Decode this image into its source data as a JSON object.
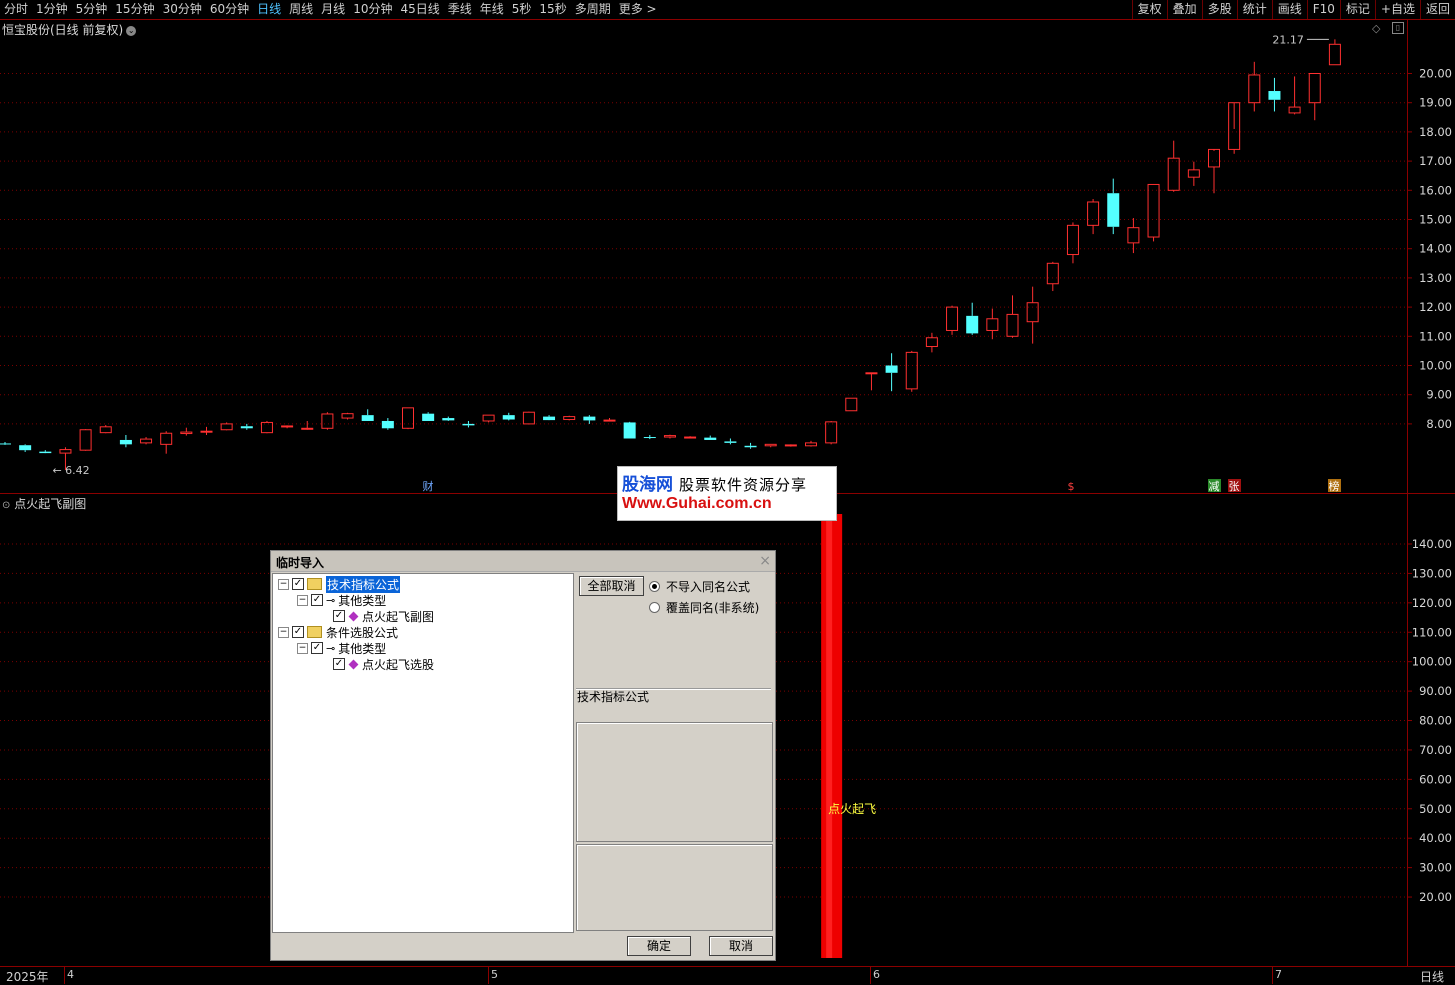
{
  "toolbar": {
    "tabs": [
      "分时",
      "1分钟",
      "5分钟",
      "15分钟",
      "30分钟",
      "60分钟",
      "日线",
      "周线",
      "月线",
      "10分钟",
      "45日线",
      "季线",
      "年线",
      "5秒",
      "15秒",
      "多周期",
      "更多 >"
    ],
    "active_tab": "日线",
    "right_tools": [
      "复权",
      "叠加",
      "多股",
      "统计",
      "画线",
      "F10",
      "标记",
      "+自选",
      "返回"
    ]
  },
  "main_chart": {
    "title": "恒宝股份(日线 前复权)",
    "high_label": "21.17",
    "low_label": "6.42",
    "y_axis": [
      "20.00",
      "19.00",
      "18.00",
      "17.00",
      "16.00",
      "15.00",
      "14.00",
      "13.00",
      "12.00",
      "11.00",
      "10.00",
      "9.00",
      "8.00"
    ],
    "markers": [
      "财",
      "$",
      "减",
      "张",
      "榜"
    ]
  },
  "sub_chart": {
    "title": "点火起飞副图",
    "signal_label": "点火起飞",
    "y_axis": [
      "140.00",
      "130.00",
      "120.00",
      "110.00",
      "100.00",
      "90.00",
      "80.00",
      "70.00",
      "60.00",
      "50.00",
      "40.00",
      "30.00",
      "20.00"
    ]
  },
  "x_axis": {
    "year": "2025年",
    "months": [
      "4",
      "5",
      "6",
      "7"
    ],
    "period": "日线"
  },
  "watermark": {
    "line1a": "股海网",
    "line1b": "股票软件资源分享",
    "line2": "Www.Guhai.com.cn"
  },
  "dialog": {
    "title": "临时导入",
    "tree": [
      {
        "label": "技术指标公式"
      },
      {
        "label": "其他类型"
      },
      {
        "label": "点火起飞副图"
      },
      {
        "label": "条件选股公式"
      },
      {
        "label": "其他类型"
      },
      {
        "label": "点火起飞选股"
      }
    ],
    "cancel_all": "全部取消",
    "radio_no_import": "不导入同名公式",
    "radio_overwrite": "覆盖同名(非系统)",
    "info_label": "技术指标公式",
    "ok": "确定",
    "cancel": "取消"
  },
  "colors": {
    "up": "#ff3030",
    "down": "#54ffff",
    "grid": "#7a0000",
    "axis": "#8b0000"
  },
  "chart_data": {
    "type": "candlestick",
    "title": "恒宝股份(日线 前复权)",
    "ylim": [
      7.4,
      21.3
    ],
    "candles": [
      {
        "o": 7.33,
        "h": 7.38,
        "l": 7.28,
        "c": 7.3
      },
      {
        "o": 7.27,
        "h": 7.3,
        "l": 7.04,
        "c": 7.1
      },
      {
        "o": 7.05,
        "h": 7.1,
        "l": 7.02,
        "c": 7.0
      },
      {
        "o": 7.0,
        "h": 7.2,
        "l": 6.42,
        "c": 7.12
      },
      {
        "o": 7.1,
        "h": 7.82,
        "l": 7.08,
        "c": 7.8
      },
      {
        "o": 7.7,
        "h": 7.96,
        "l": 7.68,
        "c": 7.9
      },
      {
        "o": 7.45,
        "h": 7.62,
        "l": 7.2,
        "c": 7.3
      },
      {
        "o": 7.35,
        "h": 7.55,
        "l": 7.3,
        "c": 7.48
      },
      {
        "o": 7.3,
        "h": 7.75,
        "l": 6.98,
        "c": 7.68
      },
      {
        "o": 7.67,
        "h": 7.87,
        "l": 7.6,
        "c": 7.72
      },
      {
        "o": 7.72,
        "h": 7.9,
        "l": 7.62,
        "c": 7.75
      },
      {
        "o": 7.8,
        "h": 8.05,
        "l": 7.78,
        "c": 8.0
      },
      {
        "o": 7.92,
        "h": 8.0,
        "l": 7.8,
        "c": 7.85
      },
      {
        "o": 7.7,
        "h": 8.1,
        "l": 7.68,
        "c": 8.05
      },
      {
        "o": 7.9,
        "h": 7.95,
        "l": 7.85,
        "c": 7.93
      },
      {
        "o": 7.85,
        "h": 8.1,
        "l": 7.8,
        "c": 7.85
      },
      {
        "o": 7.85,
        "h": 8.4,
        "l": 7.8,
        "c": 8.34
      },
      {
        "o": 8.2,
        "h": 8.38,
        "l": 8.15,
        "c": 8.35
      },
      {
        "o": 8.3,
        "h": 8.5,
        "l": 8.15,
        "c": 8.1
      },
      {
        "o": 8.1,
        "h": 8.2,
        "l": 7.8,
        "c": 7.85
      },
      {
        "o": 7.85,
        "h": 8.55,
        "l": 7.82,
        "c": 8.55
      },
      {
        "o": 8.35,
        "h": 8.4,
        "l": 8.1,
        "c": 8.1
      },
      {
        "o": 8.2,
        "h": 8.25,
        "l": 8.1,
        "c": 8.12
      },
      {
        "o": 8.0,
        "h": 8.1,
        "l": 7.88,
        "c": 7.95
      },
      {
        "o": 8.1,
        "h": 8.3,
        "l": 8.05,
        "c": 8.3
      },
      {
        "o": 8.3,
        "h": 8.38,
        "l": 8.12,
        "c": 8.15
      },
      {
        "o": 8.0,
        "h": 8.42,
        "l": 7.98,
        "c": 8.4
      },
      {
        "o": 8.25,
        "h": 8.3,
        "l": 8.15,
        "c": 8.13
      },
      {
        "o": 8.15,
        "h": 8.28,
        "l": 8.12,
        "c": 8.25
      },
      {
        "o": 8.25,
        "h": 8.3,
        "l": 8.0,
        "c": 8.12
      },
      {
        "o": 8.12,
        "h": 8.2,
        "l": 8.1,
        "c": 8.13
      },
      {
        "o": 8.05,
        "h": 8.07,
        "l": 7.5,
        "c": 7.5
      },
      {
        "o": 7.55,
        "h": 7.62,
        "l": 7.48,
        "c": 7.52
      },
      {
        "o": 7.55,
        "h": 7.63,
        "l": 7.5,
        "c": 7.6
      },
      {
        "o": 7.55,
        "h": 7.58,
        "l": 7.52,
        "c": 7.55
      },
      {
        "o": 7.53,
        "h": 7.6,
        "l": 7.45,
        "c": 7.45
      },
      {
        "o": 7.4,
        "h": 7.5,
        "l": 7.3,
        "c": 7.35
      },
      {
        "o": 7.25,
        "h": 7.35,
        "l": 7.15,
        "c": 7.2
      },
      {
        "o": 7.25,
        "h": 7.3,
        "l": 7.2,
        "c": 7.3
      },
      {
        "o": 7.25,
        "h": 7.3,
        "l": 7.22,
        "c": 7.28
      },
      {
        "o": 7.25,
        "h": 7.42,
        "l": 7.22,
        "c": 7.35
      },
      {
        "o": 7.35,
        "h": 8.1,
        "l": 7.3,
        "c": 8.07
      },
      {
        "o": 8.45,
        "h": 8.88,
        "l": 8.45,
        "c": 8.88
      },
      {
        "o": 9.75,
        "h": 9.75,
        "l": 9.15,
        "c": 9.75
      },
      {
        "o": 10.0,
        "h": 10.42,
        "l": 9.12,
        "c": 9.75
      },
      {
        "o": 9.2,
        "h": 10.5,
        "l": 9.1,
        "c": 10.45
      },
      {
        "o": 10.65,
        "h": 11.12,
        "l": 10.45,
        "c": 10.95
      },
      {
        "o": 11.2,
        "h": 12.05,
        "l": 11.05,
        "c": 12.0
      },
      {
        "o": 11.7,
        "h": 12.15,
        "l": 11.05,
        "c": 11.1
      },
      {
        "o": 11.2,
        "h": 11.95,
        "l": 10.9,
        "c": 11.6
      },
      {
        "o": 11.0,
        "h": 12.4,
        "l": 10.95,
        "c": 11.75
      },
      {
        "o": 11.5,
        "h": 12.7,
        "l": 10.75,
        "c": 12.15
      },
      {
        "o": 12.8,
        "h": 13.55,
        "l": 12.55,
        "c": 13.5
      },
      {
        "o": 13.8,
        "h": 14.9,
        "l": 13.5,
        "c": 14.8
      },
      {
        "o": 14.8,
        "h": 15.7,
        "l": 14.5,
        "c": 15.6
      },
      {
        "o": 15.9,
        "h": 16.4,
        "l": 14.5,
        "c": 14.75
      },
      {
        "o": 14.2,
        "h": 15.05,
        "l": 13.85,
        "c": 14.72
      },
      {
        "o": 14.4,
        "h": 16.2,
        "l": 14.25,
        "c": 16.2
      },
      {
        "o": 16.0,
        "h": 17.7,
        "l": 15.95,
        "c": 17.1
      },
      {
        "o": 16.45,
        "h": 16.98,
        "l": 16.15,
        "c": 16.7
      },
      {
        "o": 16.8,
        "h": 17.35,
        "l": 15.9,
        "c": 17.4
      },
      {
        "o": 17.4,
        "h": 18.1,
        "l": 17.25,
        "c": 19.0
      },
      {
        "o": 19.0,
        "h": 20.4,
        "l": 18.7,
        "c": 19.95
      },
      {
        "o": 19.4,
        "h": 19.85,
        "l": 18.7,
        "c": 19.1
      },
      {
        "o": 18.65,
        "h": 19.9,
        "l": 18.6,
        "c": 18.85
      },
      {
        "o": 19.0,
        "h": 20.0,
        "l": 18.4,
        "c": 20.0
      },
      {
        "o": 20.3,
        "h": 21.17,
        "l": 20.3,
        "c": 21.0
      }
    ]
  }
}
